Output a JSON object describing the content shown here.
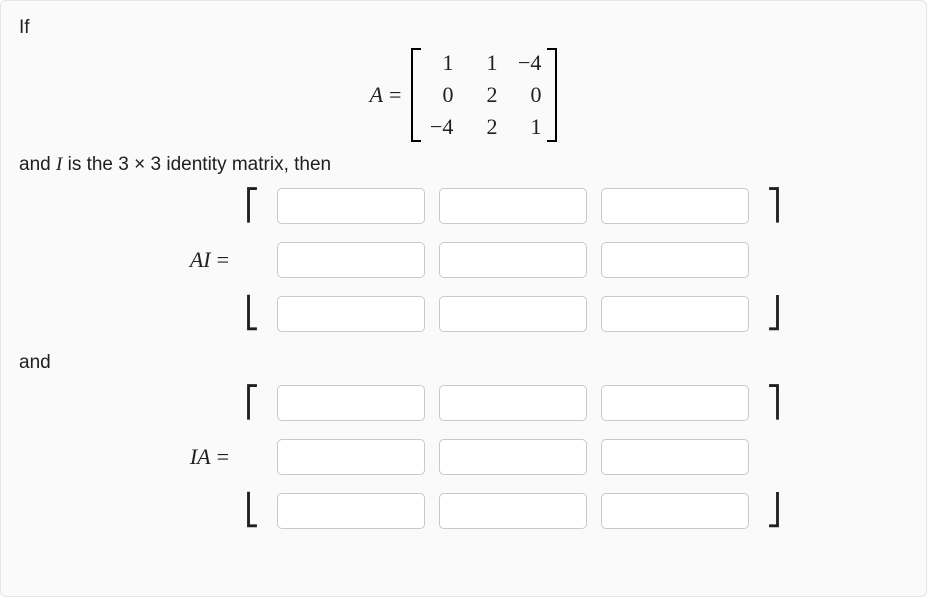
{
  "text": {
    "if": "If",
    "and_identity_pre": "and ",
    "and_identity_I": "I",
    "and_identity_mid": " is the ",
    "and_identity_dim": "3 × 3",
    "and_identity_post": " identity matrix, then",
    "and": "and"
  },
  "symbols": {
    "A": "A",
    "eq": "=",
    "AI": "AI",
    "IA": "IA",
    "lbrack_top": "⎡",
    "lbrack_bot": "⎣",
    "rbrack_top": "⎤",
    "rbrack_bot": "⎦"
  },
  "matrixA": {
    "r1c1": "1",
    "r1c2": "1",
    "r1c3": "−4",
    "r2c1": "0",
    "r2c2": "2",
    "r2c3": "0",
    "r3c1": "−4",
    "r3c2": "2",
    "r3c3": "1"
  },
  "chart_data": {
    "type": "table",
    "title": "Matrix A",
    "columns": [
      "c1",
      "c2",
      "c3"
    ],
    "rows": [
      [
        1,
        1,
        -4
      ],
      [
        0,
        2,
        0
      ],
      [
        -4,
        2,
        1
      ]
    ]
  },
  "answers": {
    "AI": {
      "r1c1": "",
      "r1c2": "",
      "r1c3": "",
      "r2c1": "",
      "r2c2": "",
      "r2c3": "",
      "r3c1": "",
      "r3c2": "",
      "r3c3": ""
    },
    "IA": {
      "r1c1": "",
      "r1c2": "",
      "r1c3": "",
      "r2c1": "",
      "r2c2": "",
      "r2c3": "",
      "r3c1": "",
      "r3c2": "",
      "r3c3": ""
    }
  }
}
